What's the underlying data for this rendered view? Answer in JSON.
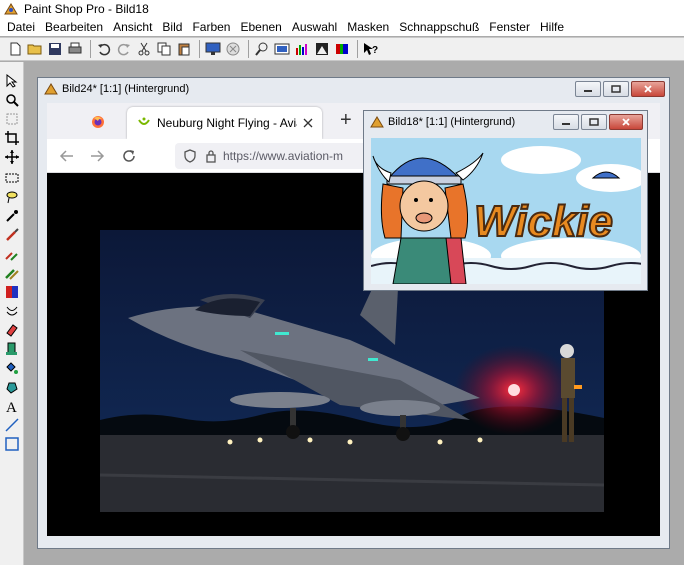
{
  "app": {
    "title": "Paint Shop Pro - Bild18"
  },
  "menu": [
    "Datei",
    "Bearbeiten",
    "Ansicht",
    "Bild",
    "Farben",
    "Ebenen",
    "Auswahl",
    "Masken",
    "Schnappschuß",
    "Fenster",
    "Hilfe"
  ],
  "toolbar": [
    "new-file",
    "open",
    "save",
    "print",
    "undo",
    "redo",
    "cut",
    "copy",
    "paste",
    "screen-capture",
    "browse",
    "zoom",
    "full-screen",
    "histogram",
    "palette",
    "layers",
    "help"
  ],
  "tools": [
    "arrow",
    "zoom",
    "deformation",
    "crop",
    "mover",
    "selection",
    "freehand-selection",
    "dropper",
    "paintbrush",
    "clone-brush",
    "color-replacer",
    "retouch",
    "scratch-remover",
    "eraser",
    "picture-tube",
    "airbrush",
    "flood-fill",
    "text",
    "line",
    "shapes"
  ],
  "windows": {
    "main": {
      "title": "Bild24* [1:1] (Hintergrund)"
    },
    "second": {
      "title": "Bild18* [1:1] (Hintergrund)"
    }
  },
  "browser": {
    "tab_title": "Neuburg Night Flying - Aviation",
    "url": "https://www.aviation-m",
    "new_tab": "+"
  },
  "cartoon": {
    "logo_text": "Wickie"
  }
}
